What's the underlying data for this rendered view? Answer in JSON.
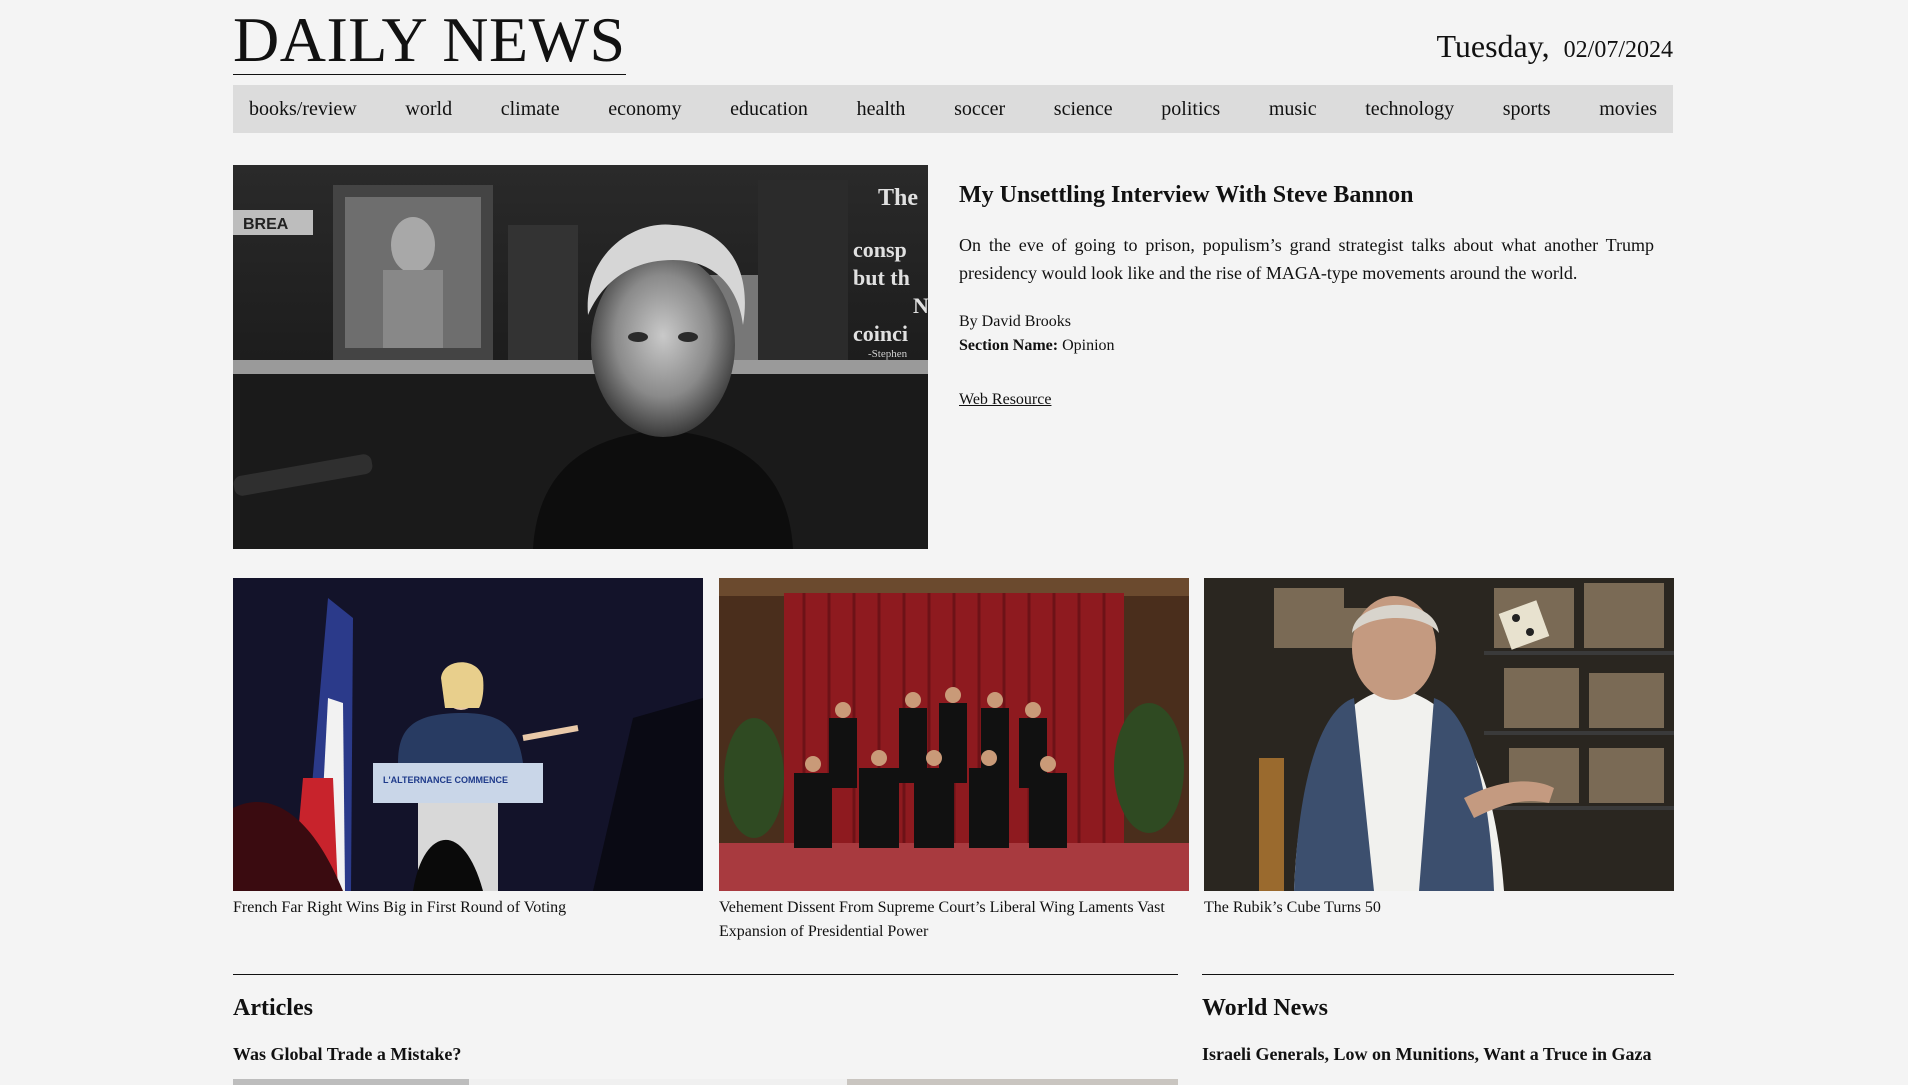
{
  "header": {
    "title": "DAILY NEWS",
    "date_day": "Tuesday,",
    "date_value": "02/07/2024"
  },
  "nav": {
    "items": [
      "books/review",
      "world",
      "climate",
      "economy",
      "education",
      "health",
      "soccer",
      "science",
      "politics",
      "music",
      "technology",
      "sports",
      "movies"
    ]
  },
  "feature": {
    "title": "My Unsettling Interview With Steve Bannon",
    "description": "On the eve of going to prison, populism’s grand strategist talks about what another Trump presidency would look like and the rise of MAGA-type movements around the world.",
    "byline": "By David Brooks",
    "section_label": "Section Name:",
    "section_value": "Opinion",
    "link": "Web Resource",
    "poster_text": [
      "The",
      "consp",
      "but th",
      "N",
      "coinci",
      "-Stephen"
    ],
    "sign_text": "BREA"
  },
  "cards": [
    {
      "caption": "French Far Right Wins Big in First Round of Voting",
      "podium_text": "L'ALTERNANCE COMMENCE"
    },
    {
      "caption": "Vehement Dissent From Supreme Court’s Liberal Wing Laments Vast Expansion of Presidential Power"
    },
    {
      "caption": "The Rubik’s Cube Turns 50"
    }
  ],
  "sections": {
    "articles": {
      "title": "Articles",
      "headline": "Was Global Trade a Mistake?"
    },
    "world": {
      "title": "World News",
      "headline": "Israeli Generals, Low on Munitions, Want a Truce in Gaza"
    }
  },
  "colors": {
    "background": "#f4f4f4",
    "nav_bg": "#dcdcdc",
    "curtain": "#8e1a1f",
    "stage_bg": "#1a1a2e"
  }
}
